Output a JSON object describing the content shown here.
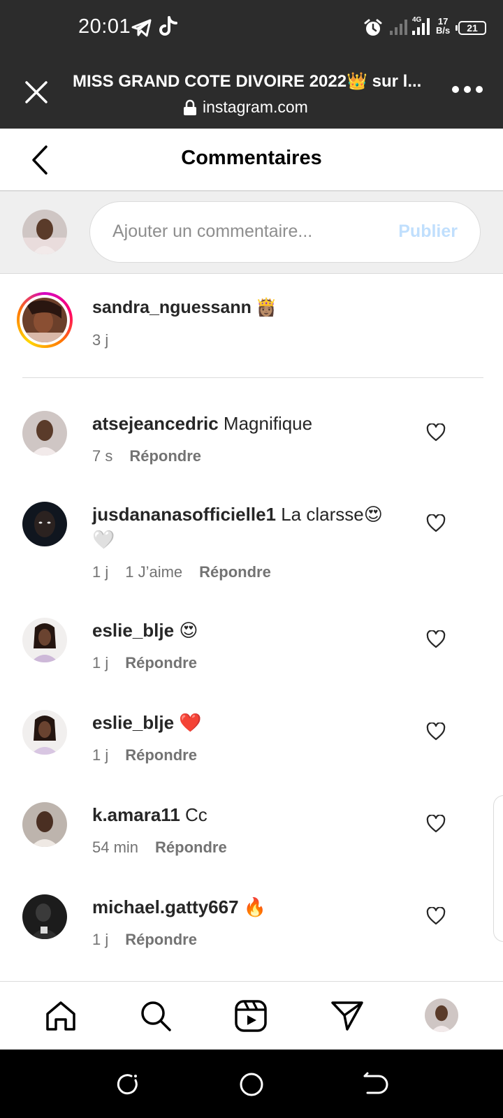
{
  "status_bar": {
    "time": "20:01",
    "network": "4G",
    "speed_value": "17",
    "speed_unit": "B/s",
    "battery": "21",
    "icons": [
      "telegram-icon",
      "tiktok-icon",
      "alarm-icon",
      "signal-icon",
      "signal-4g-icon"
    ]
  },
  "browser": {
    "title": "MISS GRAND COTE DIVOIRE 2022👑 sur l...",
    "url": "instagram.com",
    "close_icon": "close-icon",
    "more_icon": "more-icon"
  },
  "header": {
    "title": "Commentaires",
    "back_icon": "chevron-left-icon"
  },
  "composer": {
    "placeholder": "Ajouter un commentaire...",
    "publish_label": "Publier"
  },
  "caption": {
    "username": "sandra_nguessann",
    "text": "👸🏽",
    "time": "3 j"
  },
  "comments": [
    {
      "username": "atsejeancedric",
      "text": "Magnifique",
      "time": "7 s",
      "likes": "",
      "reply": "Répondre"
    },
    {
      "username": "jusdananasofficielle1",
      "text": "La clarsse😍🤍",
      "time": "1 j",
      "likes": "1 J’aime",
      "reply": "Répondre"
    },
    {
      "username": "eslie_blje",
      "text": "😍",
      "time": "1 j",
      "likes": "",
      "reply": "Répondre"
    },
    {
      "username": "eslie_blje",
      "text": "❤️",
      "time": "1 j",
      "likes": "",
      "reply": "Répondre"
    },
    {
      "username": "k.amara11",
      "text": "Cc",
      "time": "54 min",
      "likes": "",
      "reply": "Répondre"
    },
    {
      "username": "michael.gatty667",
      "text": "🔥",
      "time": "1 j",
      "likes": "",
      "reply": "Répondre"
    }
  ],
  "bottom_nav": [
    "home-icon",
    "search-icon",
    "reels-icon",
    "direct-icon",
    "profile-avatar"
  ],
  "colors": {
    "bar_dark": "#2c2c2c",
    "publish_disabled": "#c0dffd",
    "meta_gray": "#737373",
    "border": "#dbdbdb"
  }
}
